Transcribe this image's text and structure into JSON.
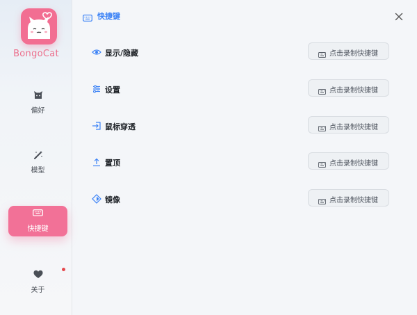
{
  "app": {
    "name": "BongoCat",
    "logo_icon": "cat-heart-logo",
    "accent": "#f27197"
  },
  "sidebar": {
    "items": [
      {
        "label": "偏好",
        "icon": "cat-face-icon",
        "active": false
      },
      {
        "label": "模型",
        "icon": "magic-wand-icon",
        "active": false
      },
      {
        "label": "快捷键",
        "icon": "keyboard-icon",
        "active": true
      },
      {
        "label": "关于",
        "icon": "heart-icon",
        "active": false,
        "badge": true
      }
    ]
  },
  "header": {
    "title": "快捷键",
    "icon": "keyboard-icon",
    "title_color": "#3b82f6"
  },
  "shortcuts": [
    {
      "label": "显示/隐藏",
      "icon": "eye-icon",
      "button": "点击录制快捷键"
    },
    {
      "label": "设置",
      "icon": "sliders-icon",
      "button": "点击录制快捷键"
    },
    {
      "label": "鼠标穿透",
      "icon": "enter-icon",
      "button": "点击录制快捷键"
    },
    {
      "label": "置顶",
      "icon": "pin-top-icon",
      "button": "点击录制快捷键"
    },
    {
      "label": "镜像",
      "icon": "mirror-icon",
      "button": "点击录制快捷键"
    }
  ]
}
